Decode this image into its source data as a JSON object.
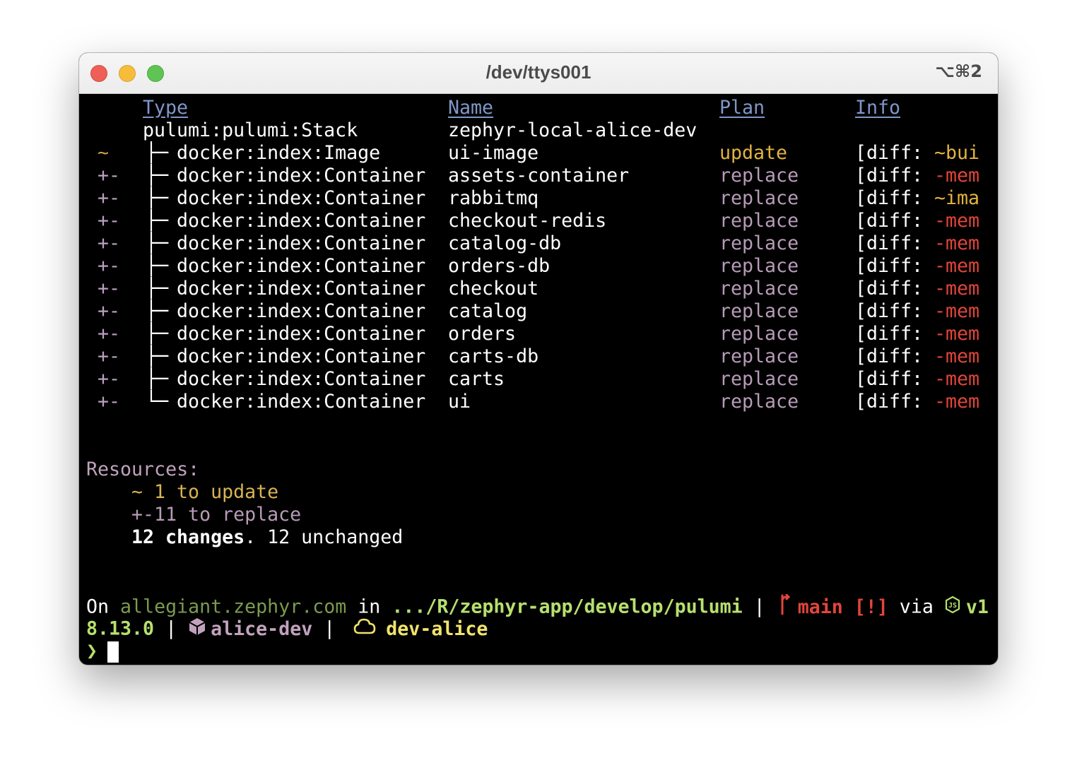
{
  "window": {
    "title": "/dev/ttys001",
    "shortcut": "⌥⌘2"
  },
  "table": {
    "headers": {
      "type": "Type",
      "name": "Name",
      "plan": "Plan",
      "info": "Info"
    },
    "root": {
      "type": "pulumi:pulumi:Stack",
      "name": "zephyr-local-alice-dev"
    },
    "rows": [
      {
        "op": "~",
        "tree": "├─",
        "type": "docker:index:Image",
        "name": "ui-image",
        "plan": "update",
        "diff_prefix": "[diff: ",
        "diff": "~bui",
        "kind": "update"
      },
      {
        "op": "+-",
        "tree": "├─",
        "type": "docker:index:Container",
        "name": "assets-container",
        "plan": "replace",
        "diff_prefix": "[diff: ",
        "diff": "-mem",
        "kind": "replace"
      },
      {
        "op": "+-",
        "tree": "├─",
        "type": "docker:index:Container",
        "name": "rabbitmq",
        "plan": "replace",
        "diff_prefix": "[diff: ",
        "diff": "~ima",
        "kind": "replace-update"
      },
      {
        "op": "+-",
        "tree": "├─",
        "type": "docker:index:Container",
        "name": "checkout-redis",
        "plan": "replace",
        "diff_prefix": "[diff: ",
        "diff": "-mem",
        "kind": "replace"
      },
      {
        "op": "+-",
        "tree": "├─",
        "type": "docker:index:Container",
        "name": "catalog-db",
        "plan": "replace",
        "diff_prefix": "[diff: ",
        "diff": "-mem",
        "kind": "replace"
      },
      {
        "op": "+-",
        "tree": "├─",
        "type": "docker:index:Container",
        "name": "orders-db",
        "plan": "replace",
        "diff_prefix": "[diff: ",
        "diff": "-mem",
        "kind": "replace"
      },
      {
        "op": "+-",
        "tree": "├─",
        "type": "docker:index:Container",
        "name": "checkout",
        "plan": "replace",
        "diff_prefix": "[diff: ",
        "diff": "-mem",
        "kind": "replace"
      },
      {
        "op": "+-",
        "tree": "├─",
        "type": "docker:index:Container",
        "name": "catalog",
        "plan": "replace",
        "diff_prefix": "[diff: ",
        "diff": "-mem",
        "kind": "replace"
      },
      {
        "op": "+-",
        "tree": "├─",
        "type": "docker:index:Container",
        "name": "orders",
        "plan": "replace",
        "diff_prefix": "[diff: ",
        "diff": "-mem",
        "kind": "replace"
      },
      {
        "op": "+-",
        "tree": "├─",
        "type": "docker:index:Container",
        "name": "carts-db",
        "plan": "replace",
        "diff_prefix": "[diff: ",
        "diff": "-mem",
        "kind": "replace"
      },
      {
        "op": "+-",
        "tree": "├─",
        "type": "docker:index:Container",
        "name": "carts",
        "plan": "replace",
        "diff_prefix": "[diff: ",
        "diff": "-mem",
        "kind": "replace"
      },
      {
        "op": "+-",
        "tree": "└─",
        "type": "docker:index:Container",
        "name": "ui",
        "plan": "replace",
        "diff_prefix": "[diff: ",
        "diff": "-mem",
        "kind": "replace"
      }
    ]
  },
  "resources": {
    "title": "Resources:",
    "update_line": "~ 1 to update",
    "replace_line": "+-11 to replace",
    "changes_bold": "12 changes",
    "changes_rest": ". 12 unchanged"
  },
  "prompt": {
    "on": "On ",
    "host": "allegiant.zephyr.com",
    "in": " in ",
    "path": ".../R/zephyr-app/develop/pulumi",
    "sep1": " | ",
    "branch": "main [!]",
    "via": " via ",
    "node_version_a": "v1",
    "node_version_b": "8.13.0",
    "sep2": " | ",
    "stack": "alice-dev",
    "sep3": " | ",
    "cloud": "dev-alice",
    "prompt_char": "❯",
    "icons": {
      "branch": "git-branch-icon",
      "node": "nodejs-icon",
      "stack": "package-icon",
      "cloud": "cloud-icon"
    }
  },
  "colors": {
    "background": "#000000",
    "header": "#7f97c9",
    "update": "#e3b341",
    "replace": "#b79bb8",
    "diff_minus": "#e2453a",
    "green": "#b6e06e"
  }
}
